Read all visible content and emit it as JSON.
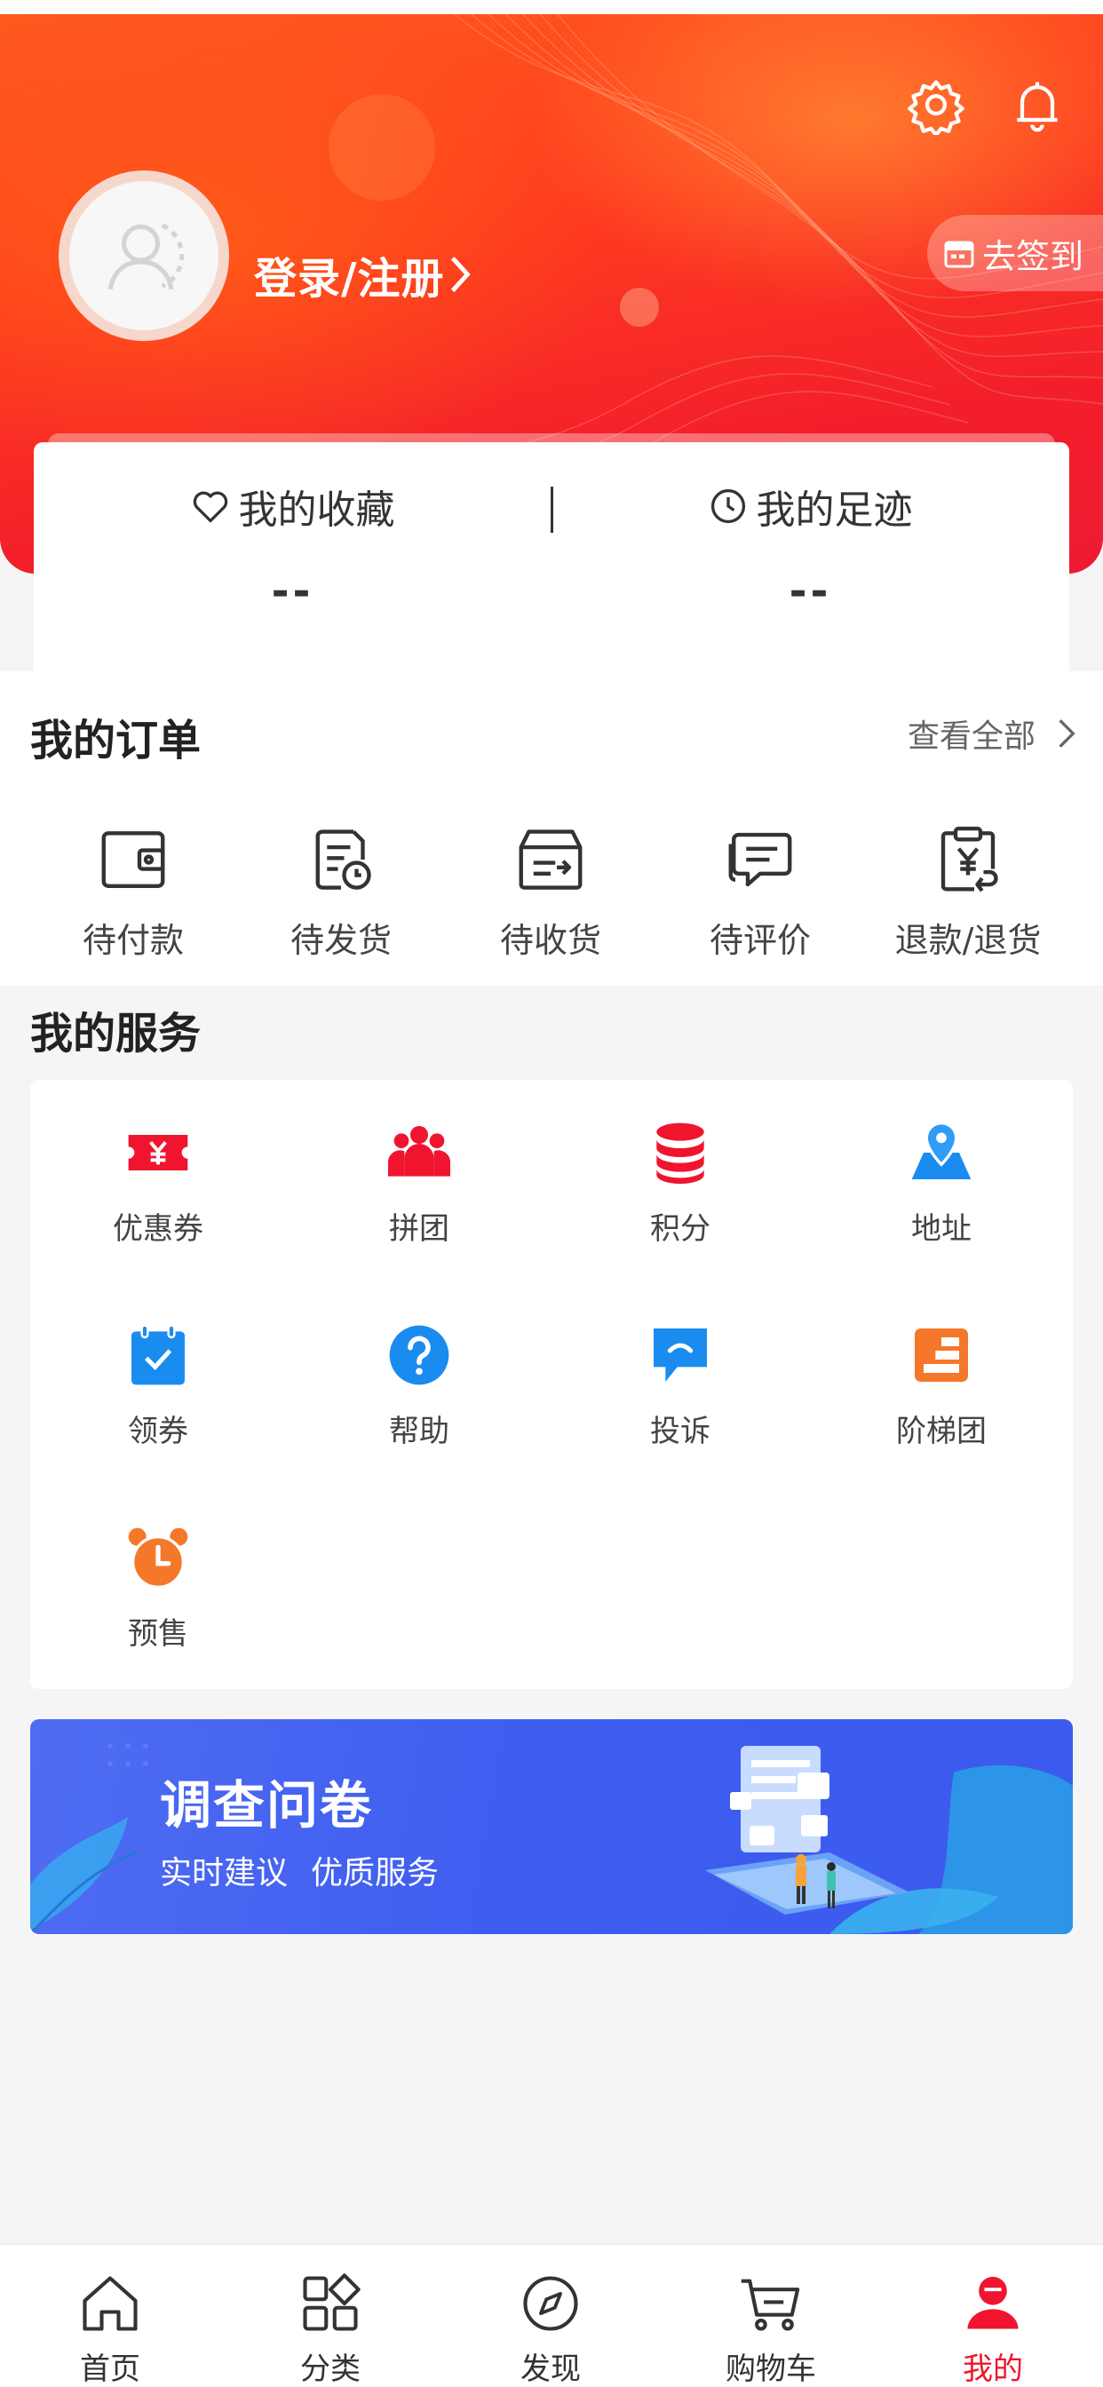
{
  "header": {
    "login_label": "登录/注册",
    "checkin_label": "去签到",
    "settings_icon": "gear-icon",
    "notification_icon": "bell-icon"
  },
  "stats": [
    {
      "label": "我的收藏",
      "value": "--",
      "icon": "heart-icon"
    },
    {
      "label": "我的足迹",
      "value": "--",
      "icon": "clock-icon"
    }
  ],
  "orders": {
    "title": "我的订单",
    "view_all": "查看全部",
    "items": [
      {
        "label": "待付款",
        "icon": "wallet-icon"
      },
      {
        "label": "待发货",
        "icon": "clock-document-icon"
      },
      {
        "label": "待收货",
        "icon": "box-icon"
      },
      {
        "label": "待评价",
        "icon": "comment-icon"
      },
      {
        "label": "退款/退货",
        "icon": "refund-clipboard-icon"
      }
    ]
  },
  "services": {
    "title": "我的服务",
    "items": [
      {
        "label": "优惠券",
        "icon": "coupon-icon"
      },
      {
        "label": "拼团",
        "icon": "group-icon"
      },
      {
        "label": "积分",
        "icon": "coins-icon"
      },
      {
        "label": "地址",
        "icon": "map-pin-icon"
      },
      {
        "label": "领券",
        "icon": "calendar-check-icon"
      },
      {
        "label": "帮助",
        "icon": "help-icon"
      },
      {
        "label": "投诉",
        "icon": "complaint-bubble-icon"
      },
      {
        "label": "阶梯团",
        "icon": "ladder-icon"
      },
      {
        "label": "预售",
        "icon": "alarm-clock-icon"
      }
    ]
  },
  "survey": {
    "title": "调查问卷",
    "subtitle_1": "实时建议",
    "subtitle_2": "优质服务"
  },
  "tabbar": {
    "active": "我的",
    "tabs": [
      {
        "label": "首页",
        "icon": "home-icon"
      },
      {
        "label": "分类",
        "icon": "category-icon"
      },
      {
        "label": "发现",
        "icon": "compass-icon"
      },
      {
        "label": "购物车",
        "icon": "cart-icon"
      },
      {
        "label": "我的",
        "icon": "profile-icon"
      }
    ]
  },
  "colors": {
    "brand_red": "#f0142f",
    "header_orange": "#ff5a1e",
    "service_red": "#f0142f",
    "service_blue": "#1a8cf0",
    "service_orange": "#f5782a",
    "survey_blue": "#3f5ef0"
  }
}
